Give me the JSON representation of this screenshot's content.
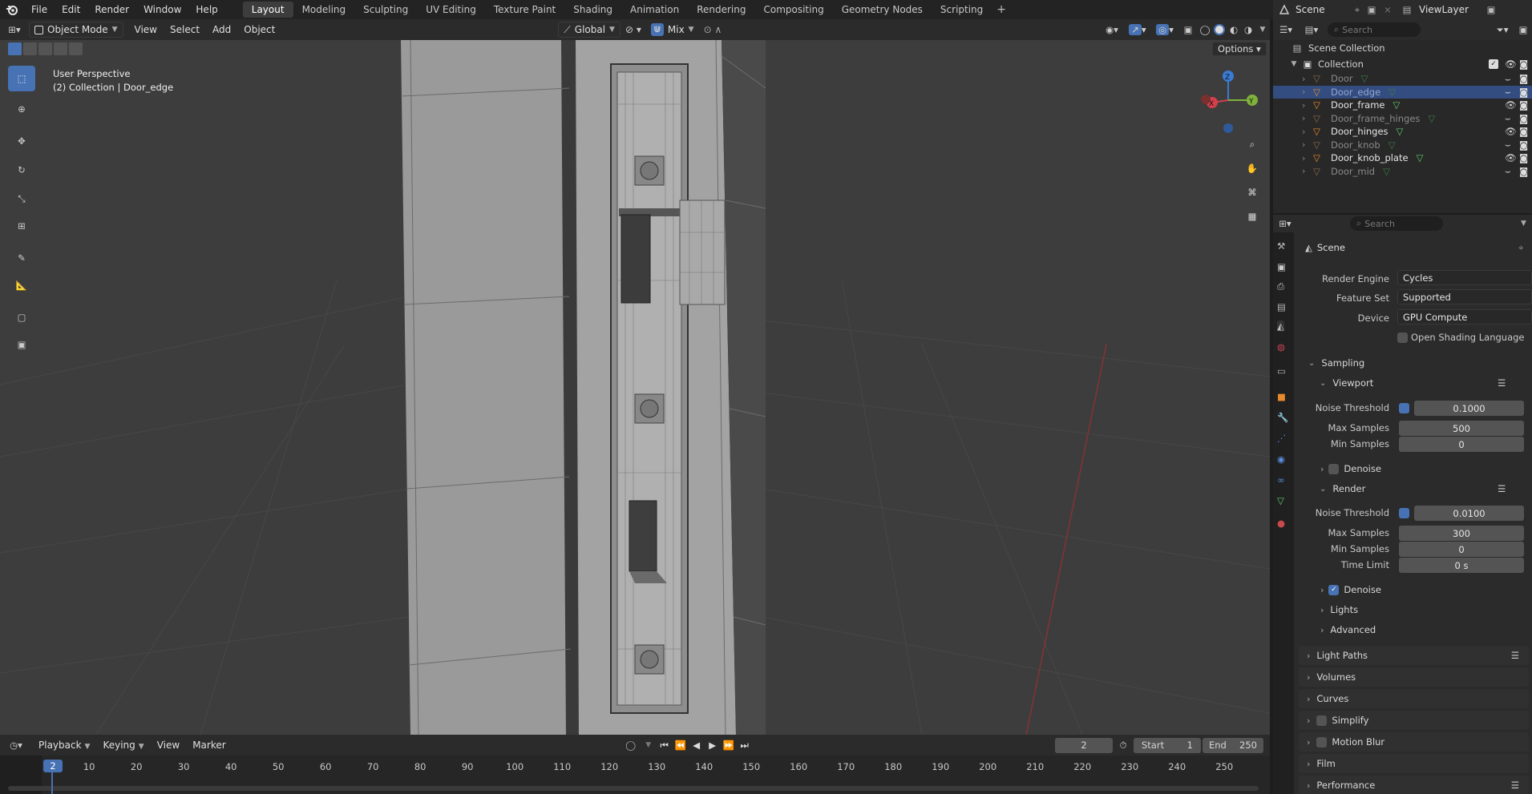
{
  "topbar": {
    "menus": [
      "File",
      "Edit",
      "Render",
      "Window",
      "Help"
    ],
    "workspaces": [
      "Layout",
      "Modeling",
      "Sculpting",
      "UV Editing",
      "Texture Paint",
      "Shading",
      "Animation",
      "Rendering",
      "Compositing",
      "Geometry Nodes",
      "Scripting"
    ],
    "active_workspace": "Layout",
    "add_tab": "+",
    "scene": "Scene",
    "view_layer": "ViewLayer"
  },
  "viewport_header": {
    "mode": "Object Mode",
    "menus": [
      "View",
      "Select",
      "Add",
      "Object"
    ],
    "orientation": "Global",
    "snap": "Mix",
    "options": "Options"
  },
  "viewport": {
    "view_name": "User Perspective",
    "context": "(2) Collection | Door_edge",
    "gizmo_axes": [
      "X",
      "Y",
      "Z"
    ]
  },
  "outliner": {
    "search_placeholder": "Search",
    "scene_collection": "Scene Collection",
    "collection": "Collection",
    "items": [
      {
        "name": "Door",
        "visible": false,
        "selected": false
      },
      {
        "name": "Door_edge",
        "visible": false,
        "selected": true
      },
      {
        "name": "Door_frame",
        "visible": true,
        "selected": false
      },
      {
        "name": "Door_frame_hinges",
        "visible": false,
        "selected": false
      },
      {
        "name": "Door_hinges",
        "visible": true,
        "selected": false
      },
      {
        "name": "Door_knob",
        "visible": false,
        "selected": false
      },
      {
        "name": "Door_knob_plate",
        "visible": true,
        "selected": false
      },
      {
        "name": "Door_mid",
        "visible": false,
        "selected": false
      }
    ]
  },
  "properties": {
    "search_placeholder": "Search",
    "context_title": "Scene",
    "render_engine": {
      "label": "Render Engine",
      "value": "Cycles"
    },
    "feature_set": {
      "label": "Feature Set",
      "value": "Supported"
    },
    "device": {
      "label": "Device",
      "value": "GPU Compute"
    },
    "osl": {
      "label": "Open Shading Language",
      "checked": false
    },
    "sampling": "Sampling",
    "viewport_section": "Viewport",
    "viewport": {
      "noise_threshold": {
        "label": "Noise Threshold",
        "value": "0.1000",
        "checked": true
      },
      "max_samples": {
        "label": "Max Samples",
        "value": "500"
      },
      "min_samples": {
        "label": "Min Samples",
        "value": "0"
      },
      "denoise": {
        "label": "Denoise",
        "checked": false
      }
    },
    "render_section": "Render",
    "render": {
      "noise_threshold": {
        "label": "Noise Threshold",
        "value": "0.0100",
        "checked": true
      },
      "max_samples": {
        "label": "Max Samples",
        "value": "300"
      },
      "min_samples": {
        "label": "Min Samples",
        "value": "0"
      },
      "time_limit": {
        "label": "Time Limit",
        "value": "0 s"
      },
      "denoise": {
        "label": "Denoise",
        "checked": true
      }
    },
    "lights": "Lights",
    "advanced": "Advanced",
    "light_paths": "Light Paths",
    "volumes": "Volumes",
    "curves": "Curves",
    "simplify": "Simplify",
    "motion_blur": "Motion Blur",
    "film": "Film",
    "performance": "Performance"
  },
  "timeline": {
    "menus": [
      "Playback",
      "Keying",
      "View",
      "Marker"
    ],
    "current_frame": "2",
    "start_label": "Start",
    "start": "1",
    "end_label": "End",
    "end": "250",
    "ticks": [
      "10",
      "20",
      "30",
      "40",
      "50",
      "60",
      "70",
      "80",
      "90",
      "100",
      "110",
      "120",
      "130",
      "140",
      "150",
      "160",
      "170",
      "180",
      "190",
      "200",
      "210",
      "220",
      "230",
      "240",
      "250"
    ]
  },
  "colors": {
    "accent": "#4772b3",
    "selection": "#334d80",
    "axis_x": "#d3404b",
    "axis_y": "#7fb13c",
    "axis_z": "#3a7bd4"
  }
}
